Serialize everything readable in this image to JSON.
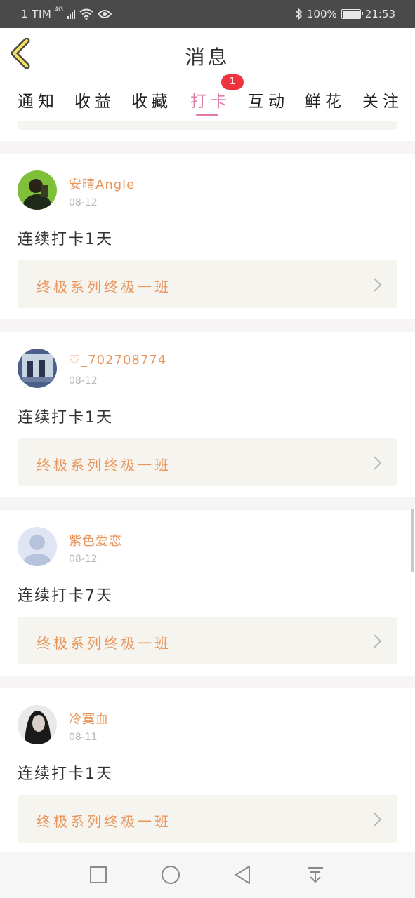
{
  "status_bar": {
    "carrier": "1 TIM",
    "network": "4G",
    "battery": "100%",
    "time": "21:53"
  },
  "header": {
    "title": "消息",
    "back_icon": "chevron-left-icon"
  },
  "tabs": [
    {
      "label": "通知",
      "active": false
    },
    {
      "label": "收益",
      "active": false
    },
    {
      "label": "收藏",
      "active": false
    },
    {
      "label": "打卡",
      "active": true,
      "badge": "1"
    },
    {
      "label": "互动",
      "active": false
    },
    {
      "label": "鲜花",
      "active": false
    },
    {
      "label": "关注",
      "active": false
    }
  ],
  "checkins": [
    {
      "user": "安晴Angle",
      "date": "08-12",
      "text": "连续打卡1天",
      "course": "终极系列终极一班"
    },
    {
      "user": "♡_702708774",
      "date": "08-12",
      "text": "连续打卡1天",
      "course": "终极系列终极一班"
    },
    {
      "user": "紫色爱恋",
      "date": "08-12",
      "text": "连续打卡7天",
      "course": "终极系列终极一班"
    },
    {
      "user": "冷寞血",
      "date": "08-11",
      "text": "连续打卡1天",
      "course": "终极系列终极一班"
    }
  ],
  "colors": {
    "accent_pink": "#e07aa8",
    "name_orange": "#e8965c",
    "badge_red": "#f1323f",
    "course_bg": "#f5f4ee"
  },
  "nav": [
    "square-icon",
    "circle-icon",
    "triangle-back-icon",
    "download-icon"
  ]
}
